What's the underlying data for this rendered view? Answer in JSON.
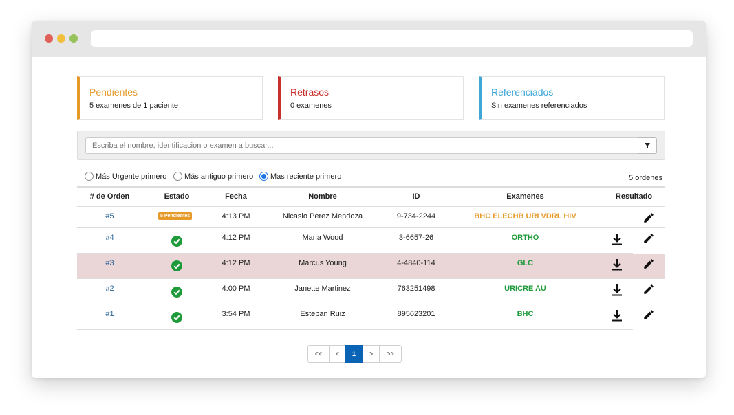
{
  "cards": [
    {
      "title": "Pendientes",
      "subtitle": "5 examenes de 1 paciente"
    },
    {
      "title": "Retrasos",
      "subtitle": "0 examenes"
    },
    {
      "title": "Referenciados",
      "subtitle": "Sin examenes referenciados"
    }
  ],
  "search": {
    "placeholder": "Escriba el nombre, identificacion o examen a buscar...",
    "value": ""
  },
  "sort": {
    "options": [
      "Más Urgente primero",
      "Más antiguo primero",
      "Mas reciente primero"
    ],
    "selected": "Mas reciente primero"
  },
  "order_count": "5 ordenes",
  "table": {
    "headers": [
      "# de Orden",
      "Estado",
      "Fecha",
      "Nombre",
      "ID",
      "Examenes",
      "Resultado"
    ],
    "rows": [
      {
        "order": "#5",
        "status": "5 Pendientes",
        "time": "4:13 PM",
        "name": "Nicasio Perez Mendoza",
        "id": "9-734-2244",
        "exams": "BHC ELECHB URI VDRL HIV",
        "pending": true
      },
      {
        "order": "#4",
        "status": "done",
        "time": "4:12 PM",
        "name": "Maria Wood",
        "id": "3-6657-26",
        "exams": "ORTHO",
        "pending": false
      },
      {
        "order": "#3",
        "status": "done",
        "time": "4:12 PM",
        "name": "Marcus Young",
        "id": "4-4840-114",
        "exams": "GLC",
        "pending": false
      },
      {
        "order": "#2",
        "status": "done",
        "time": "4:00 PM",
        "name": "Janette Martinez",
        "id": "763251498",
        "exams": "URICRE AU",
        "pending": false
      },
      {
        "order": "#1",
        "status": "done",
        "time": "3:54 PM",
        "name": "Esteban Ruiz",
        "id": "895623201",
        "exams": "BHC",
        "pending": false
      }
    ]
  },
  "pagination": {
    "first": "<<",
    "prev": "<",
    "current": "1",
    "next": ">",
    "last": ">>"
  },
  "icons": {
    "filter": "filter-icon",
    "done": "check-circle-icon",
    "download": "download-icon",
    "edit": "pencil-icon"
  },
  "colors": {
    "pending": "#e59a2a",
    "delay": "#c9302c",
    "referred": "#3ea7d8",
    "done": "#1e9a3a",
    "active_page": "#0b63b5",
    "highlight_row": "#ebd6d7"
  }
}
